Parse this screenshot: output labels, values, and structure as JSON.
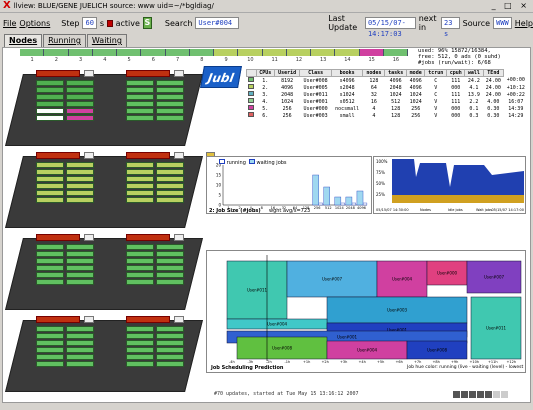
{
  "window": {
    "title": "llview: BLUE/GENE JUELICH source: www uid=~/*bgldiag/",
    "controls": "_ □ ×"
  },
  "toolbar": {
    "file": "File",
    "options": "Options",
    "step_label": "Step",
    "step_value": "60",
    "step_unit": "s",
    "active_label": "active",
    "search_label": "Search",
    "search_value": "User#004",
    "last_update_label": "Last Update",
    "last_update_value": "05/15/07-14:17:03",
    "next_in_label": "next in",
    "next_in_value": "23 s",
    "source_label": "Source",
    "source_value": "WWW",
    "help": "Help"
  },
  "tabs": [
    {
      "label": "Nodes"
    },
    {
      "label": "Running"
    },
    {
      "label": "Waiting"
    }
  ],
  "rack_numbers": [
    "1",
    "2",
    "3",
    "4",
    "5",
    "6",
    "7",
    "8",
    "9",
    "10",
    "11",
    "12",
    "13",
    "14",
    "15",
    "16"
  ],
  "rackbar_colors": [
    "#70c070",
    "#70c070",
    "#70c070",
    "#70c070",
    "#70c070",
    "#70c070",
    "#70c070",
    "#70c070",
    "#b8d060",
    "#b8d060",
    "#b8d060",
    "#b8d060",
    "#b8d060",
    "#b8d060",
    "#d040a0",
    "#70c070"
  ],
  "usage": {
    "line1": "used:  96% 15872/16384,",
    "line2": "free: 512, 0 ads (0 suhd)",
    "line3": "#jobs (run/wait): 6/68"
  },
  "logo": {
    "text": "Jubl"
  },
  "jobs": {
    "headers": [
      "CPUs",
      "Userid",
      "Class",
      "books",
      "nodes",
      "tasks",
      "mode",
      "tcrun",
      "cpuh",
      "wall",
      "TEnd"
    ],
    "rows": [
      {
        "color": "#70c070",
        "n": "1.",
        "cpus": "8192",
        "user": "User#008",
        "cls": "s4096",
        "books": "128",
        "nodes": "4096",
        "tasks": "4096",
        "mode": "C",
        "tcrun": "111",
        "cpuh": "24.2",
        "wall": "24.00",
        "tend": "+00:00"
      },
      {
        "color": "#b8d060",
        "n": "2.",
        "cpus": "4096",
        "user": "User#005",
        "cls": "s2048",
        "books": "64",
        "nodes": "2048",
        "tasks": "4096",
        "mode": "V",
        "tcrun": "000",
        "cpuh": "4.1",
        "wall": "24.00",
        "tend": "+10:12"
      },
      {
        "color": "#60b0c0",
        "n": "3.",
        "cpus": "2048",
        "user": "User#011",
        "cls": "s1024",
        "books": "32",
        "nodes": "1024",
        "tasks": "1024",
        "mode": "C",
        "tcrun": "111",
        "cpuh": "13.9",
        "wall": "24.00",
        "tend": "+00:22"
      },
      {
        "color": "#90d090",
        "n": "4.",
        "cpus": "1024",
        "user": "User#001",
        "cls": "s0512",
        "books": "16",
        "nodes": "512",
        "tasks": "1024",
        "mode": "V",
        "tcrun": "111",
        "cpuh": "2.2",
        "wall": "4.00",
        "tend": "16:07"
      },
      {
        "color": "#d040a0",
        "n": "5.",
        "cpus": "256",
        "user": "User#000",
        "cls": "nocsmall",
        "books": "4",
        "nodes": "128",
        "tasks": "256",
        "mode": "V",
        "tcrun": "000",
        "cpuh": "0.1",
        "wall": "0.30",
        "tend": "14:39"
      },
      {
        "color": "#e06060",
        "n": "6.",
        "cpus": "256",
        "user": "User#003",
        "cls": "small",
        "books": "4",
        "nodes": "128",
        "tasks": "256",
        "mode": "V",
        "tcrun": "000",
        "cpuh": "0.3",
        "wall": "0.30",
        "tend": "14:29"
      }
    ]
  },
  "chart_data": [
    {
      "type": "bar",
      "title": "2: Job Size (#jobs)",
      "legend": [
        "running",
        "waiting jobs"
      ],
      "categories": [
        "1",
        "2",
        "4",
        "8",
        "16",
        "32",
        "64",
        "128",
        "256",
        "512",
        "1024",
        "2048",
        "4096"
      ],
      "series": [
        {
          "name": "running",
          "values": [
            0,
            0,
            0,
            0,
            0,
            0,
            0,
            0,
            1,
            0,
            1,
            1,
            1
          ]
        },
        {
          "name": "waiting jobs",
          "values": [
            0,
            0,
            0,
            0,
            0,
            0,
            0,
            0,
            15,
            9,
            4,
            4,
            7
          ]
        }
      ],
      "ylim": [
        0,
        20
      ],
      "yticks": [
        "0",
        "5",
        "10",
        "15",
        "20"
      ],
      "footer": "wght avg/s=723"
    },
    {
      "type": "area",
      "title": "",
      "yticks": [
        "100%",
        "75%",
        "50%",
        "25%"
      ],
      "xlabels": [
        "05/15/07 14:30:00",
        "05/15/07 14:17:00"
      ],
      "legend": [
        "Nodes",
        "Idle jobs",
        "Wait jobs"
      ]
    }
  ],
  "schedule": {
    "title": "Job Scheduling Prediction",
    "blocks": [
      {
        "label": "User#011",
        "color": "#40c8b0"
      },
      {
        "label": "User#007",
        "color": "#50b0e0"
      },
      {
        "label": "User#004",
        "color": "#d040a0"
      },
      {
        "label": "User#000",
        "color": "#e04080"
      },
      {
        "label": "User#003",
        "color": "#30a0d0"
      },
      {
        "label": "User#004",
        "color": "#40c8c8"
      },
      {
        "label": "User#001",
        "color": "#2040c0"
      },
      {
        "label": "User#001",
        "color": "#3060d0"
      },
      {
        "label": "User#007",
        "color": "#8040c0"
      },
      {
        "label": "User#008",
        "color": "#60c040"
      },
      {
        "label": "User#004",
        "color": "#d040a0"
      },
      {
        "label": "User#008",
        "color": "#2040c0"
      },
      {
        "label": "User#011",
        "color": "#40c8b0"
      }
    ],
    "time_labels": [
      "-4h",
      "-3h",
      "-2h",
      "-1h",
      "+1h",
      "+2h",
      "+3h",
      "+4h",
      "+5h",
      "+6h",
      "+7h",
      "+8h",
      "+9h",
      "+10h",
      "+11h",
      "+12h"
    ],
    "footer": "Job hue color: running (live - waiting (level) - lowest"
  },
  "status": {
    "text": "#70 updates, started at Tue May 15 13:16:12 2007"
  }
}
